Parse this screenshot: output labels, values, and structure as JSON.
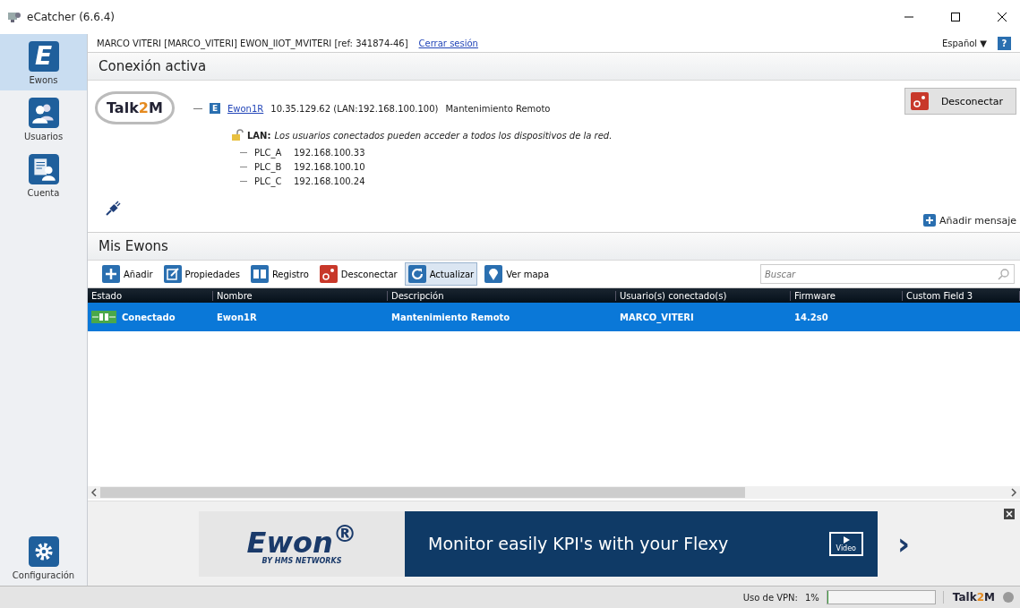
{
  "window": {
    "title": "eCatcher (6.6.4)"
  },
  "user_bar": {
    "user": "MARCO VITERI [MARCO_VITERI] EWON_IIOT_MVITERI [ref: 341874-46]",
    "logout": "Cerrar sesión",
    "language": "Español ▼",
    "help": "?"
  },
  "sidebar": {
    "items": [
      {
        "kind": "ewons",
        "glyph": "E",
        "label": "Ewons",
        "selected": true
      },
      {
        "kind": "users",
        "label": "Usuarios",
        "selected": false
      },
      {
        "kind": "account",
        "label": "Cuenta",
        "selected": false
      }
    ],
    "settings": {
      "label": "Configuración"
    }
  },
  "connection": {
    "title": "Conexión activa",
    "logo_parts": [
      "Talk",
      "2",
      "M"
    ],
    "device_badge": "E",
    "device": "Ewon1R",
    "address": "10.35.129.62 (LAN:192.168.100.100)",
    "description": "Mantenimiento Remoto",
    "lan_label": "LAN:",
    "lan_text": "Los usuarios conectados pueden acceder a todos los dispositivos de la red.",
    "plcs": [
      {
        "name": "PLC_A",
        "ip": "192.168.100.33"
      },
      {
        "name": "PLC_B",
        "ip": "192.168.100.10"
      },
      {
        "name": "PLC_C",
        "ip": "192.168.100.24"
      }
    ],
    "disconnect": "Desconectar",
    "add_message": "Añadir mensaje"
  },
  "ewons": {
    "title": "Mis Ewons",
    "toolbar": [
      {
        "kind": "add",
        "label": "Añadir",
        "selected": false
      },
      {
        "kind": "edit",
        "label": "Propiedades",
        "selected": false
      },
      {
        "kind": "log",
        "label": "Registro",
        "selected": false
      },
      {
        "kind": "disconnect",
        "label": "Desconectar",
        "selected": false
      },
      {
        "kind": "refresh",
        "label": "Actualizar",
        "selected": true
      },
      {
        "kind": "map",
        "label": "Ver mapa",
        "selected": false
      }
    ],
    "search": {
      "placeholder": "Buscar"
    },
    "columns": [
      "Estado",
      "Nombre",
      "Descripción",
      "Usuario(s) conectado(s)",
      "Firmware",
      "Custom Field 3"
    ],
    "rows": [
      {
        "selected": true,
        "cells": [
          "Conectado",
          "Ewon1R",
          "Mantenimiento Remoto",
          "MARCO_VITERI",
          "14.2s0",
          ""
        ]
      }
    ]
  },
  "banner": {
    "brand": "Ewon$^{®}$",
    "brand_sub": "BY HMS NETWORKS",
    "message": "Monitor easily KPI's with your Flexy",
    "video": "Video",
    "next": "›"
  },
  "status_bar": {
    "vpn_label": "Uso de VPN:",
    "vpn_value": "1%",
    "vpn_meter": {
      "level": 0.01
    },
    "logo_parts": [
      "Talk",
      "2",
      "M"
    ]
  }
}
